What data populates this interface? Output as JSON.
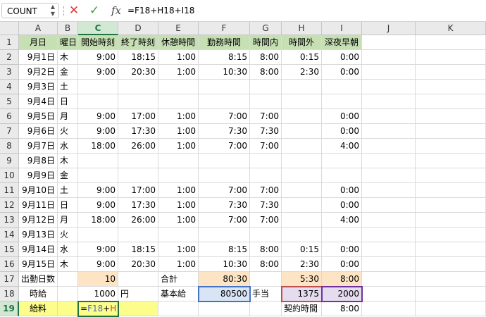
{
  "formula_bar": {
    "name_box": "COUNT",
    "formula": "=F18+H18+I18"
  },
  "columns": [
    "A",
    "B",
    "C",
    "D",
    "E",
    "F",
    "G",
    "H",
    "I",
    "J",
    "K"
  ],
  "rows": [
    "1",
    "2",
    "3",
    "4",
    "5",
    "6",
    "7",
    "8",
    "9",
    "10",
    "11",
    "12",
    "13",
    "14",
    "15",
    "16",
    "17",
    "18",
    "19"
  ],
  "colors": {
    "header_fill": "#c6e0b4",
    "orange_fill": "#fce4c4",
    "blue_fill": "#d9e4f5",
    "purple_fill": "#e5dcef",
    "yellow_fill": "#fdfd8c",
    "ref_blue": "#4472c4",
    "ref_red": "#c0504d",
    "ref_purple": "#7030a0",
    "active_green": "#217346"
  },
  "cells": {
    "A1": "月日",
    "B1": "曜日",
    "C1": "開始時刻",
    "D1": "終了時刻",
    "E1": "休憩時間",
    "F1": "勤務時間",
    "G1": "時間内",
    "H1": "時間外",
    "I1": "深夜早朝",
    "A2": "9月1日",
    "B2": "木",
    "C2": "9:00",
    "D2": "18:15",
    "E2": "1:00",
    "F2": "8:15",
    "G2": "8:00",
    "H2": "0:15",
    "I2": "0:00",
    "A3": "9月2日",
    "B3": "金",
    "C3": "9:00",
    "D3": "20:30",
    "E3": "1:00",
    "F3": "10:30",
    "G3": "8:00",
    "H3": "2:30",
    "I3": "0:00",
    "A4": "9月3日",
    "B4": "土",
    "A5": "9月4日",
    "B5": "日",
    "A6": "9月5日",
    "B6": "月",
    "C6": "9:00",
    "D6": "17:00",
    "E6": "1:00",
    "F6": "7:00",
    "G6": "7:00",
    "I6": "0:00",
    "A7": "9月6日",
    "B7": "火",
    "C7": "9:00",
    "D7": "17:30",
    "E7": "1:00",
    "F7": "7:30",
    "G7": "7:30",
    "I7": "0:00",
    "A8": "9月7日",
    "B8": "水",
    "C8": "18:00",
    "D8": "26:00",
    "E8": "1:00",
    "F8": "7:00",
    "G8": "7:00",
    "I8": "4:00",
    "A9": "9月8日",
    "B9": "木",
    "A10": "9月9日",
    "B10": "金",
    "A11": "9月10日",
    "B11": "土",
    "C11": "9:00",
    "D11": "17:00",
    "E11": "1:00",
    "F11": "7:00",
    "G11": "7:00",
    "I11": "0:00",
    "A12": "9月11日",
    "B12": "日",
    "C12": "9:00",
    "D12": "17:30",
    "E12": "1:00",
    "F12": "7:30",
    "G12": "7:30",
    "I12": "0:00",
    "A13": "9月12日",
    "B13": "月",
    "C13": "18:00",
    "D13": "26:00",
    "E13": "1:00",
    "F13": "7:00",
    "G13": "7:00",
    "I13": "4:00",
    "A14": "9月13日",
    "B14": "火",
    "A15": "9月14日",
    "B15": "水",
    "C15": "9:00",
    "D15": "18:15",
    "E15": "1:00",
    "F15": "8:15",
    "G15": "8:00",
    "H15": "0:15",
    "I15": "0:00",
    "A16": "9月15日",
    "B16": "木",
    "C16": "9:00",
    "D16": "20:30",
    "E16": "1:00",
    "F16": "10:30",
    "G16": "8:00",
    "H16": "2:30",
    "I16": "0:00",
    "A17": "出勤日数",
    "C17": "10",
    "E17": "合計",
    "F17": "80:30",
    "H17": "5:30",
    "I17": "8:00",
    "A18": "時給",
    "C18": "1000",
    "D18": "円",
    "E18": "基本給",
    "F18": "80500",
    "G18": "手当",
    "H18": "1375",
    "I18": "2000",
    "A19": "給料",
    "H19": "契約時間",
    "I19": "8:00"
  },
  "editing_cell": {
    "address": "C19",
    "parts": [
      {
        "text": "=",
        "color": "#000000"
      },
      {
        "text": "F18",
        "color": "#4472c4"
      },
      {
        "text": "+",
        "color": "#000000"
      },
      {
        "text": "H18",
        "color": "#c0504d"
      },
      {
        "text": "+",
        "color": "#000000"
      },
      {
        "text": "I18",
        "color": "#7030a0"
      }
    ]
  }
}
